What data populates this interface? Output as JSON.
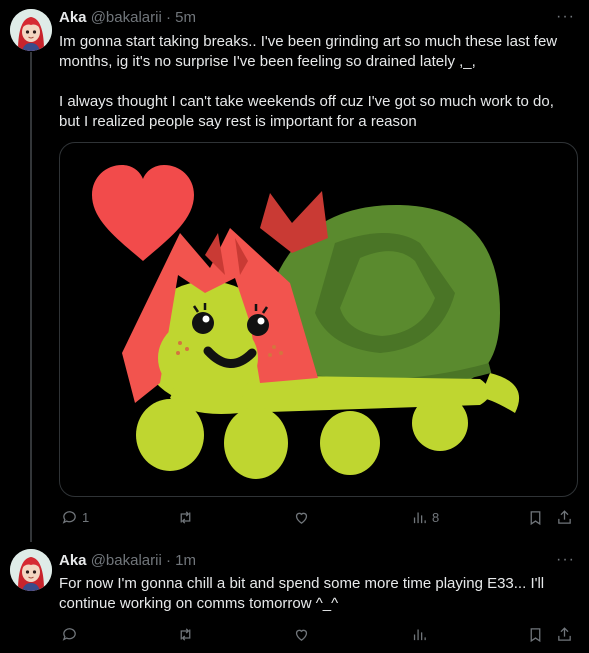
{
  "tweets": [
    {
      "name": "Aka",
      "handle": "@bakalarii",
      "dot": "·",
      "time": "5m",
      "more": "···",
      "text_line1": "Im gonna start taking breaks.. I've been grinding art so much these last few",
      "text_line2": "months, ig it's no surprise I've been feeling so drained lately ,_,",
      "text_line3": "I always thought I can't take weekends off cuz I've got so much work to do,",
      "text_line4": "but I realized people say rest is important for a reason",
      "reply_count": "1",
      "views": "8"
    },
    {
      "name": "Aka",
      "handle": "@bakalarii",
      "dot": "·",
      "time": "1m",
      "more": "···",
      "text_line1": "For now I'm gonna chill a bit and spend some more time playing E33... I'll",
      "text_line2": "continue working on comms tomorrow ^_^"
    }
  ],
  "colors": {
    "background": "#000000",
    "text": "#e7e9ea",
    "secondary": "#71767b",
    "heart": "#f24b4b",
    "turtle_body": "#bfd630",
    "turtle_shell": "#5a8a2e",
    "hair": "#f2544e"
  },
  "icons": [
    "reply-icon",
    "retweet-icon",
    "like-icon",
    "views-icon",
    "bookmark-icon",
    "share-icon",
    "more-icon"
  ]
}
